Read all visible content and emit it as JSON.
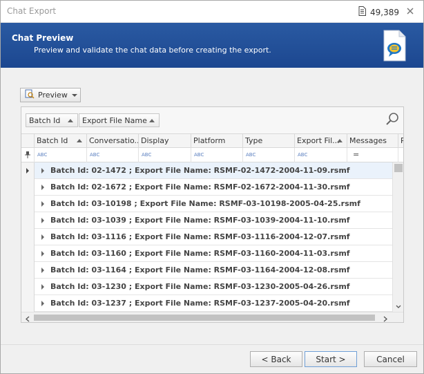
{
  "window": {
    "title": "Chat Export",
    "count": "49,389"
  },
  "header": {
    "title": "Chat Preview",
    "subtitle": "Preview and validate the chat data before creating the export."
  },
  "toolbar": {
    "preview_label": "Preview"
  },
  "grid": {
    "group_by": [
      {
        "label": "Batch Id"
      },
      {
        "label": "Export File Name"
      }
    ],
    "columns": [
      {
        "label": "Batch Id"
      },
      {
        "label": "Conversatio..."
      },
      {
        "label": "Display"
      },
      {
        "label": "Platform"
      },
      {
        "label": "Type"
      },
      {
        "label": "Export Fil..."
      },
      {
        "label": "Messages"
      },
      {
        "label": "P"
      }
    ],
    "filter_tokens": {
      "text": "ABC",
      "equals": "="
    },
    "groups": [
      {
        "text": "Batch Id: 02-1472 ; Export File Name: RSMF-02-1472-2004-11-09.rsmf"
      },
      {
        "text": "Batch Id: 02-1672 ; Export File Name: RSMF-02-1672-2004-11-30.rsmf"
      },
      {
        "text": "Batch Id: 03-10198 ; Export File Name: RSMF-03-10198-2005-04-25.rsmf"
      },
      {
        "text": "Batch Id: 03-1039 ; Export File Name: RSMF-03-1039-2004-11-10.rsmf"
      },
      {
        "text": "Batch Id: 03-1116 ; Export File Name: RSMF-03-1116-2004-12-07.rsmf"
      },
      {
        "text": "Batch Id: 03-1160 ; Export File Name: RSMF-03-1160-2004-11-03.rsmf"
      },
      {
        "text": "Batch Id: 03-1164 ; Export File Name: RSMF-03-1164-2004-12-08.rsmf"
      },
      {
        "text": "Batch Id: 03-1230 ; Export File Name: RSMF-03-1230-2005-04-26.rsmf"
      },
      {
        "text": "Batch Id: 03-1237 ; Export File Name: RSMF-03-1237-2005-04-20.rsmf"
      }
    ]
  },
  "footer": {
    "back_label": "< Back",
    "start_label": "Start >",
    "cancel_label": "Cancel"
  },
  "colors": {
    "header_band": "#1f4b94",
    "selection": "#eaf2fb"
  },
  "icons": {
    "count": "document-icon",
    "close": "close-icon",
    "header": "chat-document-icon",
    "preview": "preview-icon",
    "search": "search-icon"
  }
}
